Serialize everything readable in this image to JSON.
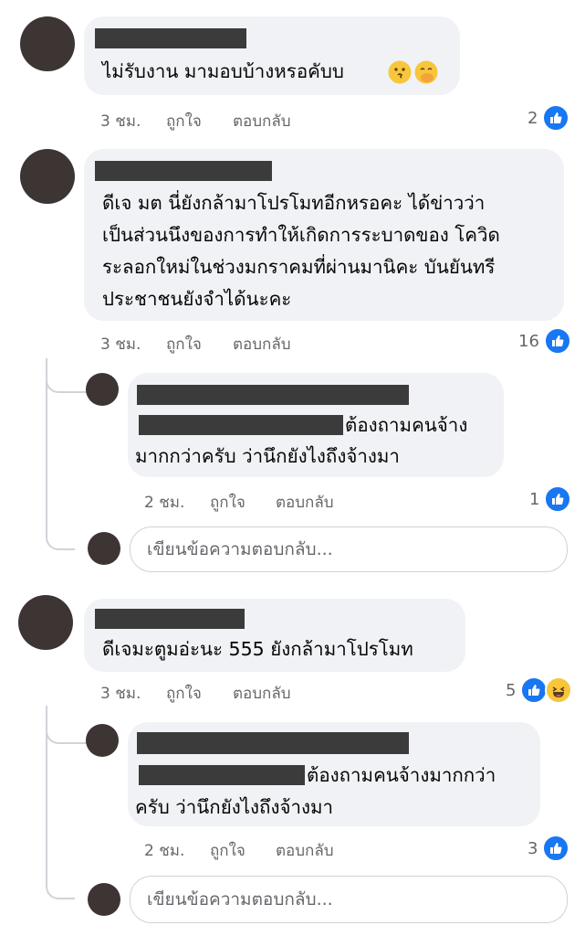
{
  "comments": [
    {
      "text_lines": [
        "ไม่รับงาน มามอบบ้างหรอคับบ"
      ],
      "time": "3 ชม.",
      "like_label": "ถูกใจ",
      "reply_label": "ตอบกลับ",
      "reaction_count": "2"
    },
    {
      "text_lines": [
        "ดีเจ มต นี่ยังกล้ามาโปรโมทอีกหรอคะ ได้ข่าวว่า",
        "เป็นส่วนนึงของการทำให้เกิดการระบาดของ โควิด",
        "ระลอกใหม่ในช่วงมกราคมที่ผ่านมานิคะ บันยันทรี",
        "ประชาชนยังจำได้นะคะ"
      ],
      "time": "3 ชม.",
      "like_label": "ถูกใจ",
      "reply_label": "ตอบกลับ",
      "reaction_count": "16",
      "reply": {
        "text_lines": [
          "ต้องถามคนจ้าง",
          "มากกว่าครับ ว่านึกยังไงถึงจ้างมา"
        ],
        "time": "2 ชม.",
        "like_label": "ถูกใจ",
        "reply_label": "ตอบกลับ",
        "reaction_count": "1"
      },
      "reply_input_placeholder": "เขียนข้อความตอบกลับ..."
    },
    {
      "text_lines": [
        "ดีเจมะตูมอ่ะนะ 555 ยังกล้ามาโปรโมท"
      ],
      "time": "3 ชม.",
      "like_label": "ถูกใจ",
      "reply_label": "ตอบกลับ",
      "reaction_count": "5",
      "reply": {
        "text_lines": [
          "ต้องถามคนจ้างมากกว่า",
          "ครับ ว่านึกยังไงถึงจ้างมา"
        ],
        "time": "2 ชม.",
        "like_label": "ถูกใจ",
        "reply_label": "ตอบกลับ",
        "reaction_count": "3"
      },
      "reply_input_placeholder": "เขียนข้อความตอบกลับ..."
    }
  ],
  "colors": {
    "bubble": "#f0f2f5",
    "like_blue": "#1877f2",
    "meta_gray": "#65676b",
    "redaction": "#3b3b3b"
  },
  "icons": [
    "like-icon",
    "haha-icon",
    "kissing-emoji",
    "hand-over-mouth-emoji"
  ]
}
